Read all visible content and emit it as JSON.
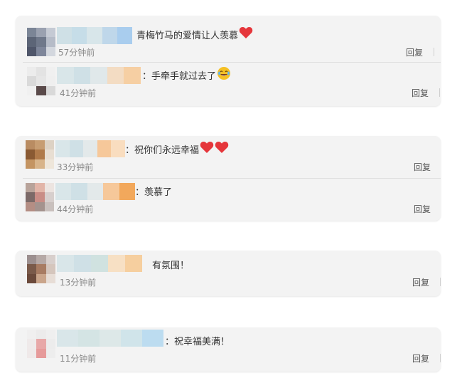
{
  "palette": {
    "card": "#f3f3f3",
    "text": "#333333",
    "time": "#888888",
    "reply": "#555555",
    "heart": "#e5363b"
  },
  "cards": [
    {
      "comments": [
        {
          "prefix": "",
          "text": "青梅竹马的爱情让人羡慕",
          "emoji": [
            "heart-icon"
          ],
          "time": "57分钟前",
          "reply": "回复"
        },
        {
          "prefix": "：",
          "text": "手牵手就过去了",
          "emoji": [
            "laughing-emoji-icon"
          ],
          "time": "41分钟前",
          "reply": "回复"
        }
      ]
    },
    {
      "comments": [
        {
          "prefix": "：",
          "text": "祝你们永远幸福",
          "emoji": [
            "heart-icon",
            "heart-icon"
          ],
          "time": "33分钟前",
          "reply": "回复"
        },
        {
          "prefix": "：",
          "text": "羡慕了",
          "emoji": [],
          "time": "44分钟前",
          "reply": "回复"
        }
      ]
    },
    {
      "comments": [
        {
          "prefix": "",
          "text": "有氛围！",
          "emoji": [],
          "time": "13分钟前",
          "reply": "回复"
        }
      ]
    },
    {
      "comments": [
        {
          "prefix": "：",
          "text": "祝幸福美满！",
          "emoji": [],
          "time": "11分钟前",
          "reply": "回复"
        }
      ]
    }
  ]
}
